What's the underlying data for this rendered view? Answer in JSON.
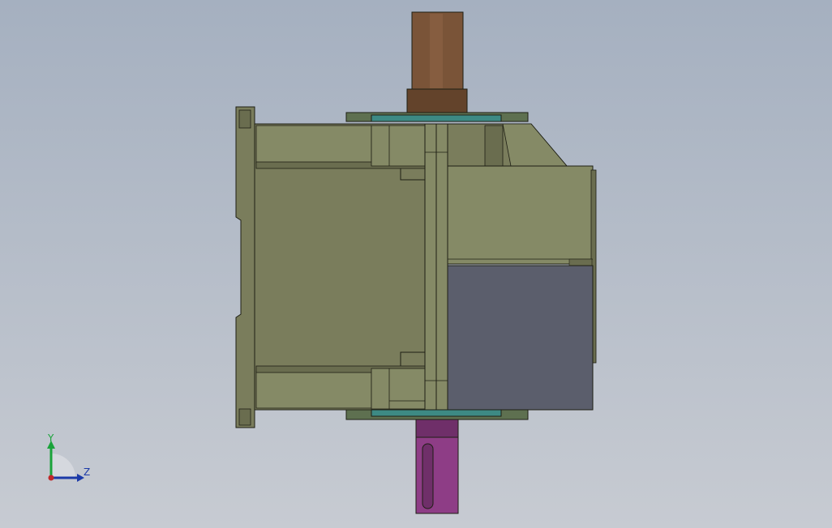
{
  "viewport": {
    "background_top": "#a5b0c0",
    "background_bottom": "#c7cbd2"
  },
  "model": {
    "colors": {
      "housing": "#7a7d5c",
      "housing_light": "#858a66",
      "housing_dark": "#6a6d4f",
      "edge": "#1e1f14",
      "output_shaft": "#7a5438",
      "output_shaft_dark": "#63432b",
      "input_shaft": "#8e3d86",
      "input_shaft_dark": "#6f2f69",
      "bearing_ring": "#3d8a84",
      "flange_plate": "#5e7050",
      "motor_block": "#5b5e6c"
    }
  },
  "triad": {
    "y_label": "Y",
    "z_label": "Z",
    "y_color": "#1aa33a",
    "z_color": "#1c3aa8",
    "origin_color": "#c0282a"
  }
}
